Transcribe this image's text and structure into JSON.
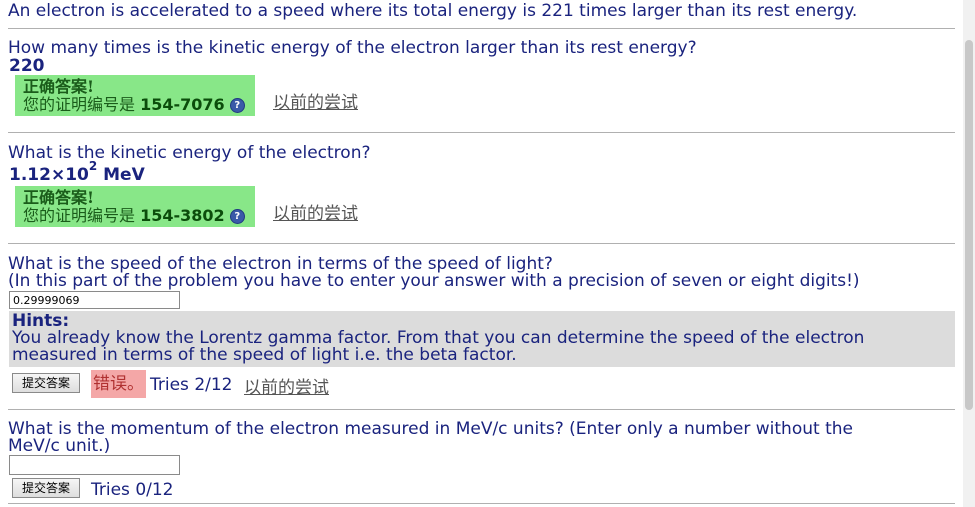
{
  "intro": "An electron is accelerated to a speed where its total energy is 221 times larger than its rest energy.",
  "q1": {
    "question": "How many times is the kinetic energy of the electron larger than its rest energy?",
    "answer": "220",
    "correct_title": "正确答案!",
    "cert_label": "您的证明编号是",
    "cert_code": "154-7076",
    "prev_link": "以前的尝试"
  },
  "q2": {
    "question": "What is the kinetic energy of the electron?",
    "answer_mantissa": "1.12×10",
    "answer_exp": "2",
    "answer_unit": " MeV",
    "correct_title": "正确答案!",
    "cert_label": "您的证明编号是",
    "cert_code": "154-3802",
    "prev_link": "以前的尝试"
  },
  "q3": {
    "question": "What is the speed of the electron in terms of the speed of light?",
    "note": "(In this part of the problem you have to enter your answer with a precision of seven or eight digits!)",
    "input_value": "0.29999069",
    "hints_title": "Hints:",
    "hints_line1": "You already know the Lorentz gamma factor. From that you can determine the speed of the electron",
    "hints_line2": "measured in terms of the speed of light i.e. the beta factor.",
    "submit_label": "提交答案",
    "status": "错误。",
    "tries": "Tries 2/12",
    "prev_link": "以前的尝试"
  },
  "q4": {
    "question_line1": "What is the momentum of the electron measured in MeV/c units? (Enter only a number without the",
    "question_line2": "MeV/c unit.)",
    "input_value": "",
    "submit_label": "提交答案",
    "tries": "Tries 0/12"
  },
  "icons": {
    "help": "question-circle-icon"
  }
}
